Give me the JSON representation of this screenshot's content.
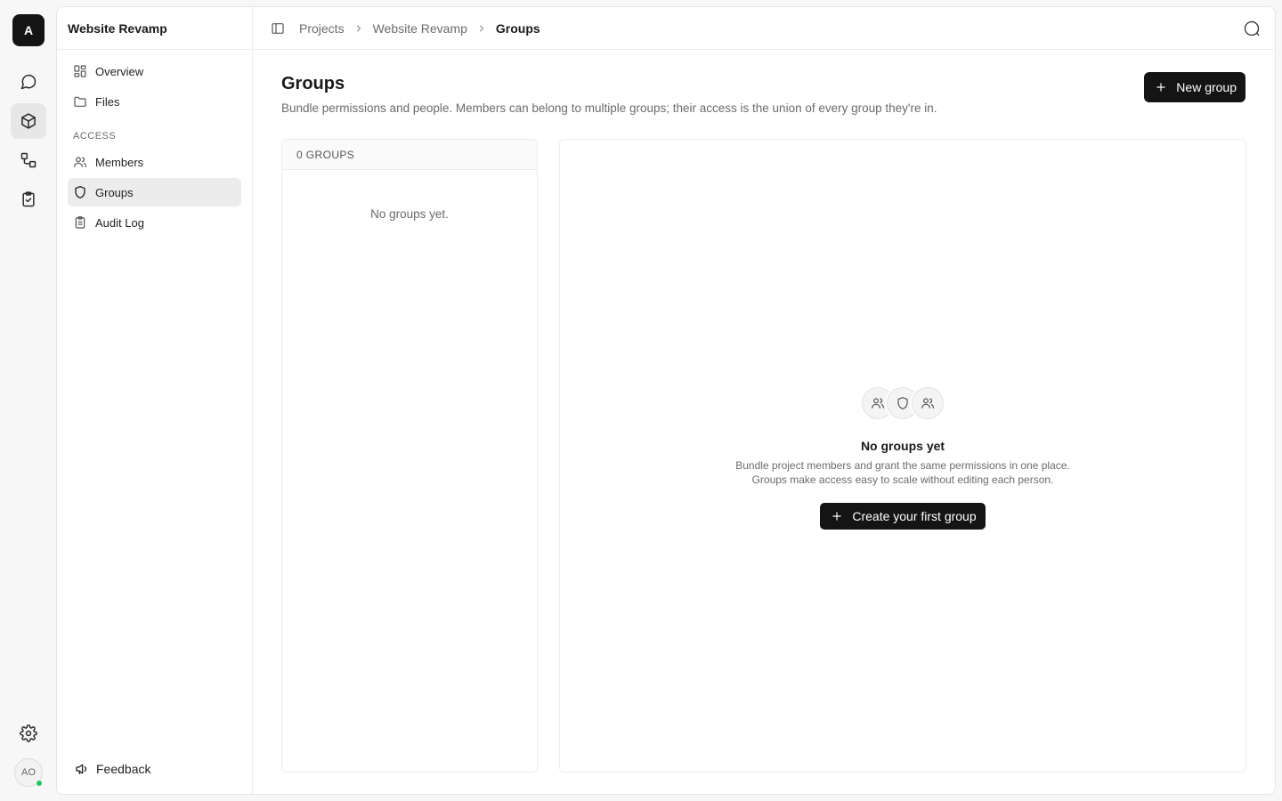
{
  "workspace": {
    "initial": "A"
  },
  "rail": {
    "items": [
      {
        "name": "chat",
        "icon": "message-circle-icon"
      },
      {
        "name": "projects",
        "icon": "box-icon",
        "active": true
      },
      {
        "name": "workflows",
        "icon": "flow-icon"
      },
      {
        "name": "tasks",
        "icon": "clipboard-check-icon"
      }
    ],
    "settings_icon": "gear-icon",
    "user_initials": "AO",
    "status_color": "#22c55e"
  },
  "sidebar": {
    "project_name": "Website Revamp",
    "items": [
      {
        "label": "Overview",
        "icon": "grid-icon"
      },
      {
        "label": "Files",
        "icon": "folder-icon"
      }
    ],
    "section_label": "ACCESS",
    "access_items": [
      {
        "label": "Members",
        "icon": "users-icon"
      },
      {
        "label": "Groups",
        "icon": "shield-icon",
        "active": true
      },
      {
        "label": "Audit Log",
        "icon": "clipboard-list-icon"
      }
    ],
    "feedback_label": "Feedback"
  },
  "breadcrumb": {
    "items": [
      "Projects",
      "Website Revamp"
    ],
    "current": "Groups"
  },
  "page": {
    "title": "Groups",
    "subtitle": "Bundle permissions and people. Members can belong to multiple groups; their access is the union of every group they're in.",
    "new_button_label": "New group"
  },
  "group_list": {
    "header": "0 GROUPS",
    "empty_text": "No groups yet."
  },
  "empty_state": {
    "title": "No groups yet",
    "line1": "Bundle project members and grant the same permissions in one place.",
    "line2": "Groups make access easy to scale without editing each person.",
    "button_label": "Create your first group"
  },
  "colors": {
    "primary": "#141414",
    "active_bg": "#ececec",
    "muted_text": "#6b6b6b"
  }
}
